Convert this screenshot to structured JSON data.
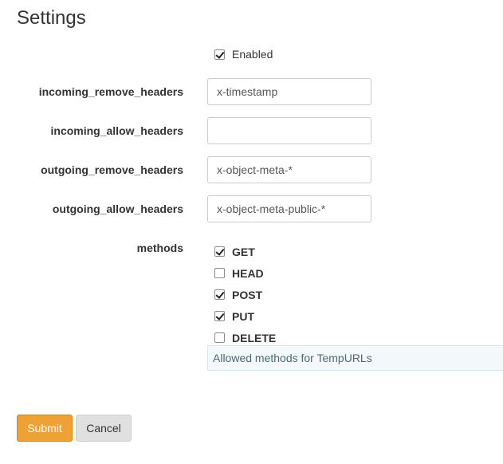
{
  "header": {
    "title": "Settings"
  },
  "enabled": {
    "label": "Enabled",
    "checked": true
  },
  "fields": {
    "incoming_remove_headers": {
      "label": "incoming_remove_headers",
      "value": "x-timestamp"
    },
    "incoming_allow_headers": {
      "label": "incoming_allow_headers",
      "value": ""
    },
    "outgoing_remove_headers": {
      "label": "outgoing_remove_headers",
      "value": "x-object-meta-*"
    },
    "outgoing_allow_headers": {
      "label": "outgoing_allow_headers",
      "value": "x-object-meta-public-*"
    }
  },
  "methods": {
    "label": "methods",
    "options": [
      {
        "label": "GET",
        "checked": true
      },
      {
        "label": "HEAD",
        "checked": false
      },
      {
        "label": "POST",
        "checked": true
      },
      {
        "label": "PUT",
        "checked": true
      },
      {
        "label": "DELETE",
        "checked": false
      }
    ],
    "help": "Allowed methods for TempURLs"
  },
  "actions": {
    "submit_label": "Submit",
    "cancel_label": "Cancel"
  },
  "colors": {
    "submit_bg": "#eea236",
    "cancel_bg": "#e0e0e0",
    "help_bg": "#f3f8fa"
  }
}
